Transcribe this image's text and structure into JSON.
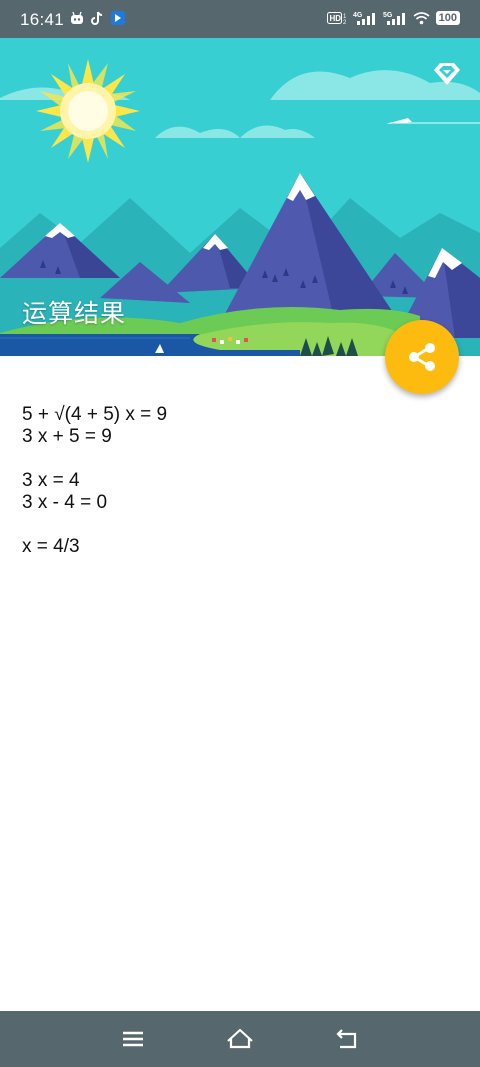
{
  "status_bar": {
    "time": "16:41",
    "battery": "100",
    "left_icons": [
      "notification-app-icon",
      "tiktok-icon",
      "app-shortcut-icon"
    ],
    "right_icons": [
      "hd-icon",
      "4g-signal-icon",
      "5g-signal-icon",
      "wifi-icon",
      "battery-icon"
    ]
  },
  "header": {
    "title": "运算结果",
    "corner_icon": "diamond-icon",
    "fab_icon": "share-icon",
    "fab_color": "#fdbb10"
  },
  "result": {
    "lines": [
      "5 + √(4 + 5) x = 9",
      "3 x + 5 = 9",
      "",
      "3 x = 4",
      "3 x - 4 = 0",
      "",
      "x = 4/3"
    ]
  },
  "nav_bar": {
    "buttons": [
      "menu-icon",
      "home-icon",
      "back-icon"
    ]
  }
}
